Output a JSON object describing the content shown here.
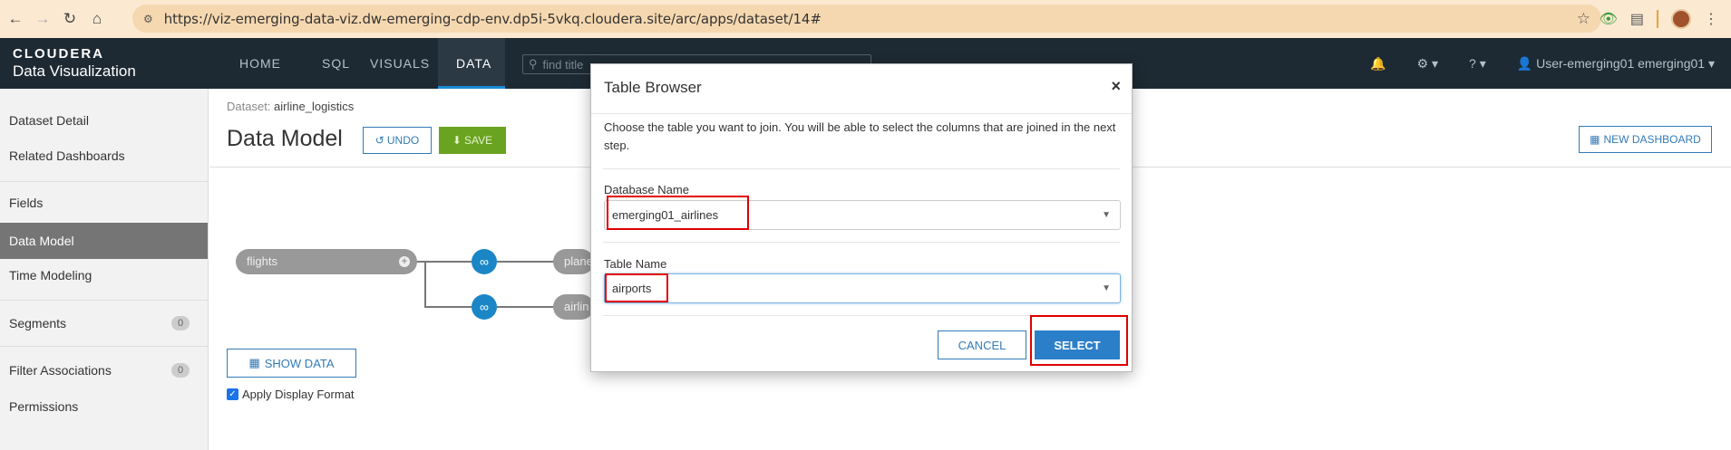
{
  "browser": {
    "url": "https://viz-emerging-data-viz.dw-emerging-cdp-env.dp5i-5vkq.cloudera.site/arc/apps/dataset/14#"
  },
  "app": {
    "logo_top": "CLOUDERA",
    "logo_bottom": "Data Visualization",
    "nav": [
      "HOME",
      "SQL",
      "VISUALS",
      "DATA"
    ],
    "active_nav": "DATA",
    "search_placeholder": "find title",
    "user": "User-emerging01 emerging01"
  },
  "sidebar": {
    "items": [
      {
        "label": "Dataset Detail"
      },
      {
        "label": "Related Dashboards"
      },
      {
        "label": "Fields"
      },
      {
        "label": "Data Model"
      },
      {
        "label": "Time Modeling"
      },
      {
        "label": "Segments",
        "count": "0"
      },
      {
        "label": "Filter Associations",
        "count": "0"
      },
      {
        "label": "Permissions"
      }
    ],
    "active": "Data Model"
  },
  "main": {
    "dataset_prefix": "Dataset:",
    "dataset_name": "airline_logistics",
    "title": "Data Model",
    "undo_label": "UNDO",
    "save_label": "SAVE",
    "new_dashboard_label": "NEW DASHBOARD",
    "show_data_label": "SHOW DATA",
    "apply_display_format": "Apply Display Format",
    "apply_checked": true,
    "tables": [
      "flights",
      "plane",
      "airlin"
    ]
  },
  "modal": {
    "title": "Table Browser",
    "close": "×",
    "description": "Choose the table you want to join. You will be able to select the columns that are joined in the next step.",
    "database_label": "Database Name",
    "database_value": "emerging01_airlines",
    "table_label": "Table Name",
    "table_value": "airports",
    "cancel_label": "CANCEL",
    "select_label": "SELECT"
  },
  "colors": {
    "nav_bg": "#1e2a33",
    "accent": "#337ab7",
    "save": "#6aa320",
    "highlight": "#e00000"
  }
}
